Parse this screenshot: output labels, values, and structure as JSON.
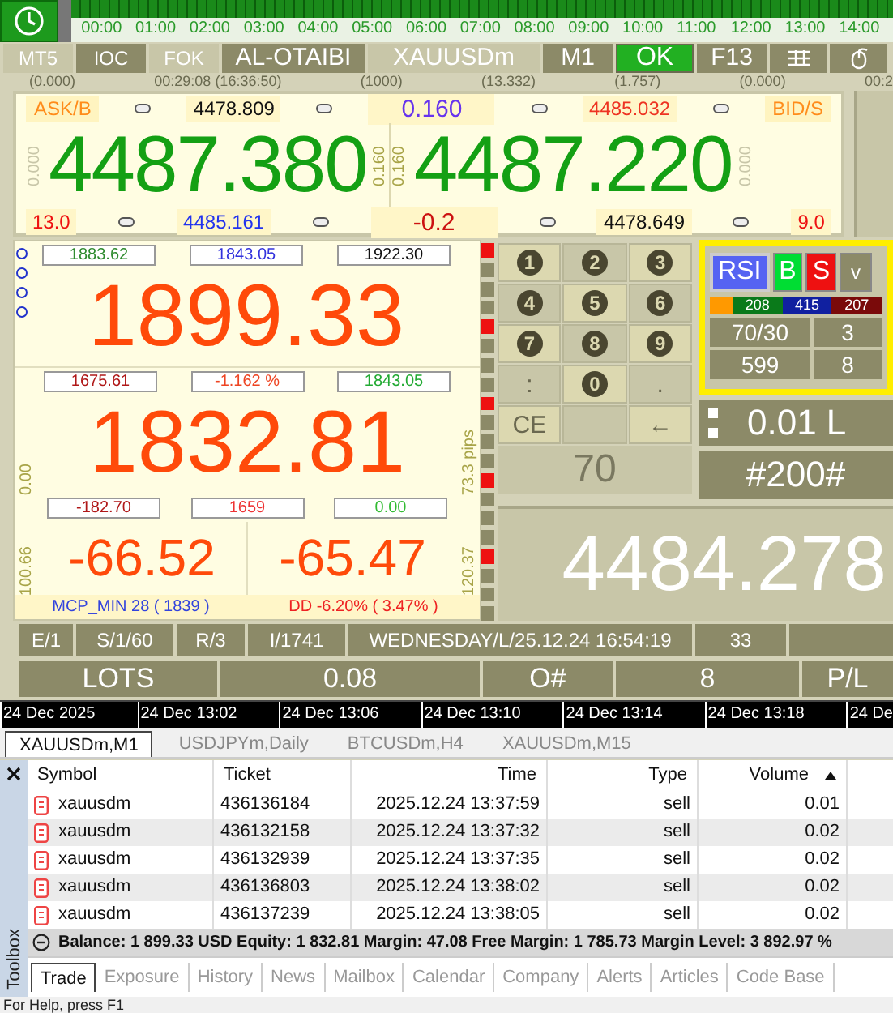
{
  "timeline": {
    "hours": [
      "00:00",
      "01:00",
      "02:00",
      "03:00",
      "04:00",
      "05:00",
      "06:00",
      "07:00",
      "08:00",
      "09:00",
      "10:00",
      "11:00",
      "12:00",
      "13:00",
      "14:00"
    ]
  },
  "toolbar": {
    "buttons": [
      {
        "label": "MT5",
        "kind": "light"
      },
      {
        "label": "IOC",
        "kind": "dark"
      },
      {
        "label": "FOK",
        "kind": "light"
      },
      {
        "label": "AL-OTAIBI",
        "kind": "dark"
      },
      {
        "label": "XAUUSDm",
        "kind": "light"
      },
      {
        "label": "M1",
        "kind": "dark"
      },
      {
        "label": "OK",
        "kind": "ok"
      },
      {
        "label": "F13",
        "kind": "dark"
      },
      {
        "kind": "grid"
      },
      {
        "kind": "mouse"
      }
    ]
  },
  "info_line": [
    "(0.000)",
    "00:29:08 (16:36:50)",
    "(1000)",
    "(13.332)",
    "(1.757)",
    "(0.000)",
    "00:2"
  ],
  "quote": {
    "ask_label": "ASK/B",
    "bid_label": "BID/S",
    "ask": "4487.380",
    "bid": "4487.220",
    "top": [
      {
        "text": "4478.809",
        "color": "#111111"
      },
      {
        "text": "0.160",
        "color": "#6633ee"
      },
      {
        "text": "4485.032",
        "color": "#ee3322"
      }
    ],
    "bottom": [
      {
        "text": "13.0",
        "color": "#ee1111"
      },
      {
        "text": "4485.161",
        "color": "#2233ee"
      },
      {
        "text": "-0.2",
        "color": "#cc1111"
      },
      {
        "text": "4478.649",
        "color": "#111111"
      },
      {
        "text": "9.0",
        "color": "#ee1111"
      }
    ],
    "side": [
      "0.000",
      "0.160",
      "0.160",
      "0.000"
    ]
  },
  "account": {
    "top_boxes": [
      {
        "text": "1883.62",
        "color": "#2e8b2e"
      },
      {
        "text": "1843.05",
        "color": "#3333dd"
      },
      {
        "text": "1922.30",
        "color": "#111111"
      }
    ],
    "balance": "1899.33",
    "mid_boxes": [
      {
        "text": "1675.61",
        "color": "#b01818"
      },
      {
        "text": "-1.162 %",
        "color": "#ee4422"
      },
      {
        "text": "1843.05",
        "color": "#22aa33"
      }
    ],
    "equity": "1832.81",
    "bottom_boxes": [
      {
        "text": "-182.70",
        "color": "#b01818"
      },
      {
        "text": "1659",
        "color": "#ee3333"
      },
      {
        "text": "0.00",
        "color": "#33bb33"
      }
    ],
    "left_labels": [
      "0.00",
      "100.66"
    ],
    "right_labels": [
      "73.3 pips",
      "120.37"
    ],
    "pl": [
      "-66.52",
      "-65.47"
    ],
    "footer": [
      {
        "text": "MCP_MIN 28 ( 1839 )",
        "color": "#3344dd"
      },
      {
        "text": "DD -6.20% ( 3.47% )",
        "color": "#ee2222"
      }
    ]
  },
  "keypad": {
    "keys": [
      {
        "label": "1",
        "kind": "digit"
      },
      {
        "label": "2",
        "kind": "digit"
      },
      {
        "label": "3",
        "kind": "digit"
      },
      {
        "label": "4",
        "kind": "digit"
      },
      {
        "label": "5",
        "kind": "digit"
      },
      {
        "label": "6",
        "kind": "digit"
      },
      {
        "label": "7",
        "kind": "digit"
      },
      {
        "label": "8",
        "kind": "digit"
      },
      {
        "label": "9",
        "kind": "digit"
      },
      {
        "label": ":",
        "kind": "plain"
      },
      {
        "label": "0",
        "kind": "digit"
      },
      {
        "label": ".",
        "kind": "plain"
      },
      {
        "label": "CE",
        "kind": "plain"
      },
      {
        "kind": "blank"
      },
      {
        "label": "←",
        "kind": "plain"
      }
    ],
    "display": "70"
  },
  "indicator": {
    "buttons": [
      {
        "label": "RSI",
        "color": "#5563f2"
      },
      {
        "label": "B",
        "color": "#00dd33"
      },
      {
        "label": "S",
        "color": "#ee1111"
      },
      {
        "label": "v",
        "color": "#8c8a68"
      }
    ],
    "counts": [
      {
        "text": "208",
        "color": "#0a7a1a"
      },
      {
        "text": "415",
        "color": "#1020a0"
      },
      {
        "text": "207",
        "color": "#7a0a0a"
      }
    ],
    "cells": [
      "70/30",
      "3",
      "599",
      "8"
    ]
  },
  "lot": {
    "size": "0.01 L",
    "tag": "#200#"
  },
  "price": "4484.278",
  "status_row": [
    "E/1",
    "S/1/60",
    "R/3",
    "I/1741",
    "WEDNESDAY/L/25.12.24 16:54:19",
    "33"
  ],
  "lot_row": [
    "LOTS",
    "0.08",
    "O#",
    "8",
    "P/L"
  ],
  "time_axis": [
    "24 Dec 2025",
    "24 Dec 13:02",
    "24 Dec 13:06",
    "24 Dec 13:10",
    "24 Dec 13:14",
    "24 Dec 13:18",
    "24 De"
  ],
  "chart_tabs": [
    {
      "label": "XAUUSDm,M1",
      "selected": true
    },
    {
      "label": "USDJPYm,Daily",
      "selected": false
    },
    {
      "label": "BTCUSDm,H4",
      "selected": false
    },
    {
      "label": "XAUUSDm,M15",
      "selected": false
    }
  ],
  "positions": {
    "columns": [
      {
        "label": "Symbol",
        "sorted": false
      },
      {
        "label": "Ticket",
        "sorted": false
      },
      {
        "label": "Time",
        "sorted": false
      },
      {
        "label": "Type",
        "sorted": false
      },
      {
        "label": "Volume",
        "sorted": true
      }
    ],
    "rows": [
      {
        "symbol": "xauusdm",
        "ticket": "436136184",
        "time": "2025.12.24 13:37:59",
        "type": "sell",
        "volume": "0.01"
      },
      {
        "symbol": "xauusdm",
        "ticket": "436132158",
        "time": "2025.12.24 13:37:32",
        "type": "sell",
        "volume": "0.02"
      },
      {
        "symbol": "xauusdm",
        "ticket": "436132939",
        "time": "2025.12.24 13:37:35",
        "type": "sell",
        "volume": "0.02"
      },
      {
        "symbol": "xauusdm",
        "ticket": "436136803",
        "time": "2025.12.24 13:38:02",
        "type": "sell",
        "volume": "0.02"
      },
      {
        "symbol": "xauusdm",
        "ticket": "436137239",
        "time": "2025.12.24 13:38:05",
        "type": "sell",
        "volume": "0.02"
      }
    ],
    "summary": "Balance: 1 899.33 USD  Equity: 1 832.81  Margin: 47.08  Free Margin: 1 785.73  Margin Level: 3 892.97 %"
  },
  "toolbox": {
    "title": "Toolbox",
    "tabs": [
      {
        "label": "Trade",
        "selected": true
      },
      {
        "label": "Exposure",
        "selected": false
      },
      {
        "label": "History",
        "selected": false
      },
      {
        "label": "News",
        "selected": false
      },
      {
        "label": "Mailbox",
        "selected": false
      },
      {
        "label": "Calendar",
        "selected": false
      },
      {
        "label": "Company",
        "selected": false
      },
      {
        "label": "Alerts",
        "selected": false
      },
      {
        "label": "Articles",
        "selected": false
      },
      {
        "label": "Code Base",
        "selected": false
      }
    ]
  },
  "status_bar": "For Help, press F1"
}
